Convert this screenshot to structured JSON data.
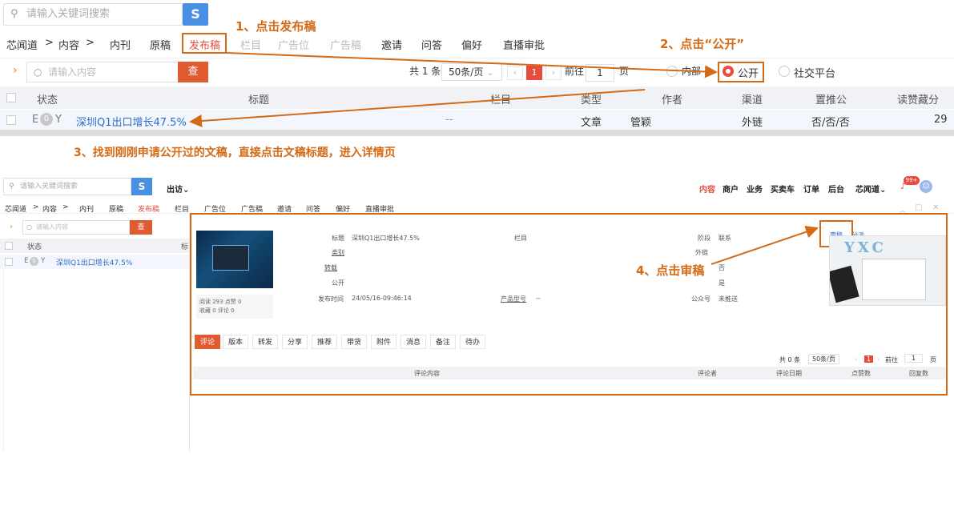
{
  "annotations": {
    "step1": "1、点击发布稿",
    "step2": "2、点击“公开”",
    "step3": "3、找到刚刚申请公开过的文稿，直接点击文稿标题，进入详情页",
    "step4": "4、点击审稿",
    "color": "#d46a15"
  },
  "top": {
    "search_placeholder": "请输入关键词搜索",
    "logo_glyph": "S",
    "nav": [
      "芯闻道",
      ">",
      "内容",
      ">",
      "内刊",
      "原稿",
      "发布稿",
      "栏目",
      "广告位",
      "广告稿",
      "邀请",
      "问答",
      "偏好",
      "直播审批"
    ],
    "filter_placeholder": "请输入内容",
    "check_label": "查",
    "chevron": "›",
    "pager": {
      "total": "共 1 条",
      "page_size": "50条/页",
      "current": "1",
      "goto_label": "前往",
      "goto_value": "1",
      "page_unit": "页"
    },
    "radios": {
      "internal": "内部",
      "public": "公开",
      "social": "社交平台"
    },
    "table_headers": [
      "状态",
      "标题",
      "栏目",
      "类型",
      "作者",
      "渠道",
      "置推公",
      "读赞藏分"
    ],
    "row": {
      "status": "E",
      "status_badge": "0",
      "status_y": "Y",
      "title": "深圳Q1出口增长47.5%",
      "column": "--",
      "type": "文章",
      "author": "管颖",
      "channel": "外链",
      "flags": "否/否/否",
      "counts": "29"
    }
  },
  "bottom": {
    "search_placeholder": "请输入关键词搜索",
    "logo_glyph": "S",
    "visit": "出访",
    "topnav": [
      "内容",
      "商户",
      "业务",
      "买卖车",
      "订单",
      "后台",
      "芯闻道"
    ],
    "badge": "99+",
    "nav": [
      "芯闻道",
      ">",
      "内容",
      ">",
      "内刊",
      "原稿",
      "发布稿",
      "栏目",
      "广告位",
      "广告稿",
      "邀请",
      "问答",
      "偏好",
      "直播审批"
    ],
    "filter_placeholder": "请输入内容",
    "check_label": "查",
    "table_headers": [
      "状态",
      "标"
    ],
    "row": {
      "status": "E",
      "status_badge": "0",
      "status_y": "Y",
      "title": "深圳Q1出口增长47.5%"
    },
    "detail": {
      "stats_line1": "阅读 293 点赞 0",
      "stats_line2": "收藏 0 评论 0",
      "title_label": "标题",
      "title_value": "深圳Q1出口增长47.5%",
      "column_label": "栏目",
      "category_label": "类别",
      "source_label": "转载",
      "public_label": "公开",
      "publish_time_label": "发布时间",
      "publish_time_value": "24/05/16-09:46:14",
      "product_label": "产品型号",
      "product_value": "--",
      "stage_label": "阶段",
      "stage_value": "联系",
      "channel_value": "外链",
      "no_value": "否",
      "is_value": "是",
      "account_label": "公众号",
      "account_value": "未推送",
      "review_link": "审稿",
      "dispatch_link": "分派",
      "ad_brand": "YXC",
      "tabs": [
        "评论",
        "版本",
        "转发",
        "分享",
        "推荐",
        "带货",
        "附件",
        "消息",
        "备注",
        "待办"
      ],
      "pager": {
        "total": "共 0 条",
        "page_size": "50条/页",
        "current": "1",
        "goto_label": "前往",
        "goto_value": "1",
        "page_unit": "页"
      },
      "table_headers": [
        "评论内容",
        "评论者",
        "评论日期",
        "点赞数",
        "回复数"
      ]
    }
  }
}
